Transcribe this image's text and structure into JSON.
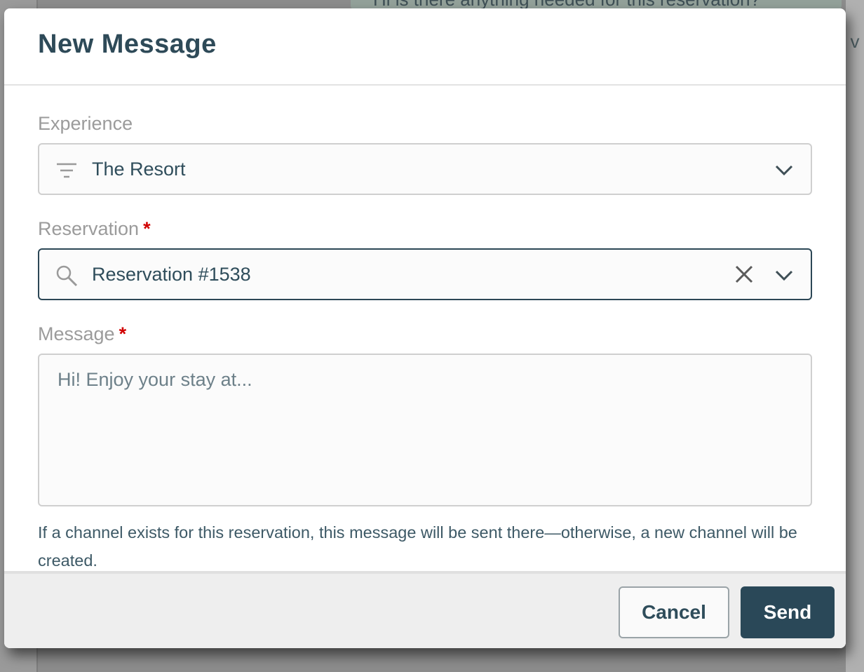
{
  "background": {
    "message_preview": "Hi is there anything needed for this reservation?",
    "right_edge_glyph": "v"
  },
  "modal": {
    "title": "New Message",
    "experience": {
      "label": "Experience",
      "value": "The Resort",
      "lead_icon": "filter-icon",
      "trailing_icon": "chevron-down-icon"
    },
    "reservation": {
      "label": "Reservation",
      "required_mark": "*",
      "value": "Reservation #1538",
      "lead_icon": "search-icon",
      "clear_icon": "close-icon",
      "trailing_icon": "chevron-down-icon"
    },
    "message": {
      "label": "Message",
      "required_mark": "*",
      "value": "",
      "placeholder": "Hi! Enjoy your stay at..."
    },
    "hint": "If a channel exists for this reservation, this message will be sent there—otherwise, a new channel will be created.",
    "footer": {
      "cancel_label": "Cancel",
      "send_label": "Send"
    }
  },
  "colors": {
    "primary": "#2a4858",
    "text": "#2f4d5b",
    "label": "#9b9b9b",
    "required": "#d10000"
  }
}
